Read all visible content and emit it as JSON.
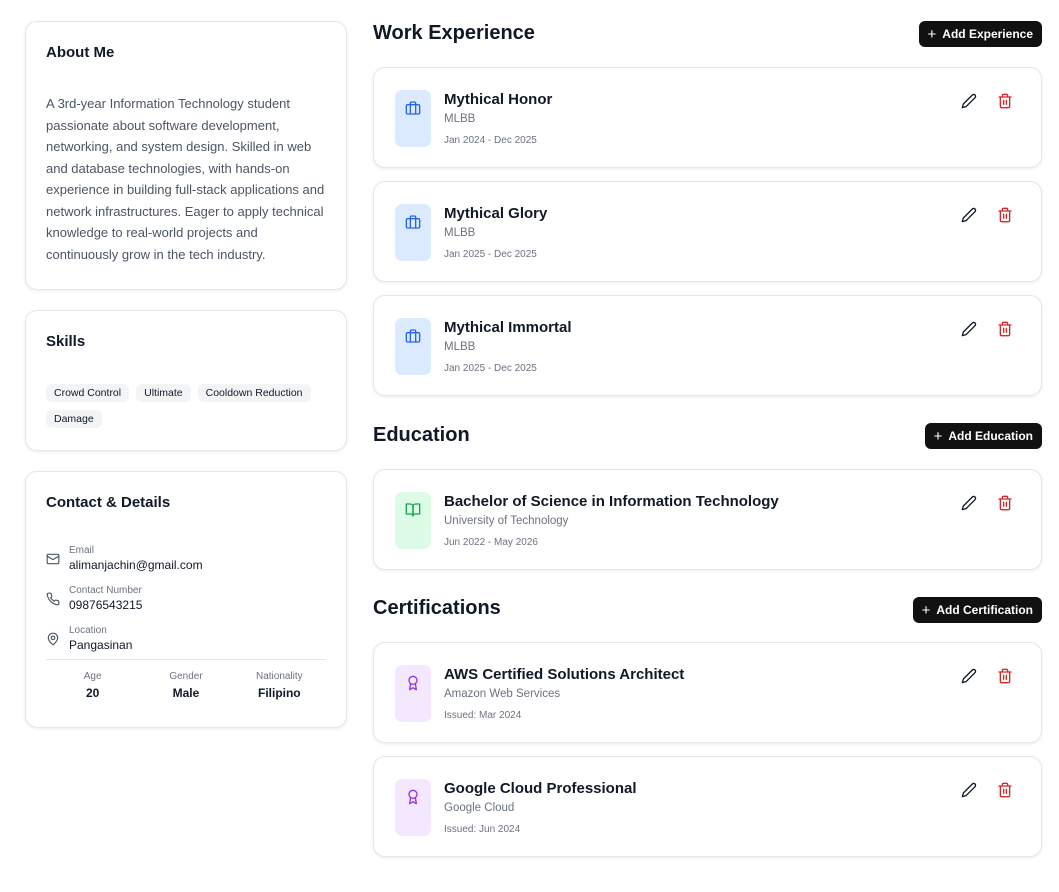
{
  "about": {
    "title": "About Me",
    "text": "A 3rd-year Information Technology student passionate about software development, networking, and system design. Skilled in web and database technologies, with hands-on experience in building full-stack applications and network infrastructures. Eager to apply technical knowledge to real-world projects and continuously grow in the tech industry."
  },
  "skills": {
    "title": "Skills",
    "items": [
      "Crowd Control",
      "Ultimate",
      "Cooldown Reduction",
      "Damage"
    ]
  },
  "contact": {
    "title": "Contact & Details",
    "email_label": "Email",
    "email": "alimanjachin@gmail.com",
    "phone_label": "Contact Number",
    "phone": "09876543215",
    "location_label": "Location",
    "location": "Pangasinan",
    "age_label": "Age",
    "age": "20",
    "gender_label": "Gender",
    "gender": "Male",
    "nationality_label": "Nationality",
    "nationality": "Filipino"
  },
  "work": {
    "title": "Work Experience",
    "add_label": "Add Experience",
    "items": [
      {
        "title": "Mythical Honor",
        "org": "MLBB",
        "date": "Jan 2024 - Dec 2025"
      },
      {
        "title": "Mythical Glory",
        "org": "MLBB",
        "date": "Jan 2025 - Dec 2025"
      },
      {
        "title": "Mythical Immortal",
        "org": "MLBB",
        "date": "Jan 2025 - Dec 2025"
      }
    ]
  },
  "education": {
    "title": "Education",
    "add_label": "Add Education",
    "items": [
      {
        "title": "Bachelor of Science in Information Technology",
        "org": "University of Technology",
        "date": "Jun 2022 - May 2026"
      }
    ]
  },
  "certifications": {
    "title": "Certifications",
    "add_label": "Add Certification",
    "items": [
      {
        "title": "AWS Certified Solutions Architect",
        "org": "Amazon Web Services",
        "date": "Issued: Mar 2024"
      },
      {
        "title": "Google Cloud Professional",
        "org": "Google Cloud",
        "date": "Issued: Jun 2024"
      }
    ]
  },
  "icons": {
    "work": "briefcase-icon",
    "education": "book-open-icon",
    "certification": "award-icon",
    "edit": "pencil-icon",
    "delete": "trash-icon"
  },
  "colors": {
    "accent_dark": "#111111",
    "delete_red": "#dc2626",
    "work_badge": "#dbeafe",
    "education_badge": "#dcfce7",
    "certification_badge": "#f3e8ff"
  }
}
